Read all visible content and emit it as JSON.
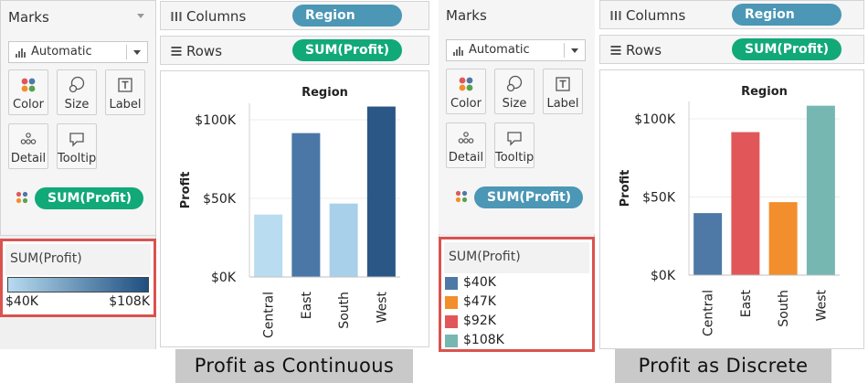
{
  "left": {
    "marks": {
      "title": "Marks",
      "mark_type": "Automatic",
      "buttons": [
        {
          "label": "Color",
          "icon": "color-icon"
        },
        {
          "label": "Size",
          "icon": "size-icon"
        },
        {
          "label": "Label",
          "icon": "label-icon"
        },
        {
          "label": "Detail",
          "icon": "detail-icon"
        },
        {
          "label": "Tooltip",
          "icon": "tooltip-icon"
        }
      ],
      "color_pill": "SUM(Profit)"
    },
    "shelves": {
      "columns_label": "Columns",
      "columns_pill": "Region",
      "rows_label": "Rows",
      "rows_pill": "SUM(Profit)"
    },
    "legend": {
      "title": "SUM(Profit)",
      "min_label": "$40K",
      "max_label": "$108K",
      "gradient_start": "#b7dbf0",
      "gradient_end": "#1f4f80"
    },
    "caption": "Profit as Continuous"
  },
  "right": {
    "marks": {
      "title": "Marks",
      "mark_type": "Automatic",
      "buttons": [
        {
          "label": "Color",
          "icon": "color-icon"
        },
        {
          "label": "Size",
          "icon": "size-icon"
        },
        {
          "label": "Label",
          "icon": "label-icon"
        },
        {
          "label": "Detail",
          "icon": "detail-icon"
        },
        {
          "label": "Tooltip",
          "icon": "tooltip-icon"
        }
      ],
      "color_pill": "SUM(Profit)"
    },
    "shelves": {
      "columns_label": "Columns",
      "columns_pill": "Region",
      "rows_label": "Rows",
      "rows_pill": "SUM(Profit)"
    },
    "legend": {
      "title": "SUM(Profit)",
      "items": [
        {
          "label": "$40K",
          "color": "#4e79a7"
        },
        {
          "label": "$47K",
          "color": "#f28e2b"
        },
        {
          "label": "$92K",
          "color": "#e15759"
        },
        {
          "label": "$108K",
          "color": "#76b7b2"
        }
      ]
    },
    "caption": "Profit as Discrete"
  },
  "chart_data": [
    {
      "type": "bar",
      "title": "Region",
      "ylabel": "Profit",
      "categories": [
        "Central",
        "East",
        "South",
        "West"
      ],
      "values": [
        39700,
        91500,
        46700,
        108400
      ],
      "ylim": [
        0,
        115000
      ],
      "yticks": [
        0,
        50000,
        100000
      ],
      "ytick_labels": [
        "$0K",
        "$50K",
        "$100K"
      ],
      "colors": [
        "#b9dcf0",
        "#4b77a6",
        "#a8d0ea",
        "#2a5785"
      ],
      "grid": true
    },
    {
      "type": "bar",
      "title": "Region",
      "ylabel": "Profit",
      "categories": [
        "Central",
        "East",
        "South",
        "West"
      ],
      "values": [
        39700,
        91500,
        46700,
        108400
      ],
      "ylim": [
        0,
        115000
      ],
      "yticks": [
        0,
        50000,
        100000
      ],
      "ytick_labels": [
        "$0K",
        "$50K",
        "$100K"
      ],
      "colors": [
        "#4e79a7",
        "#e15759",
        "#f28e2b",
        "#76b7b2"
      ],
      "grid": true
    }
  ]
}
